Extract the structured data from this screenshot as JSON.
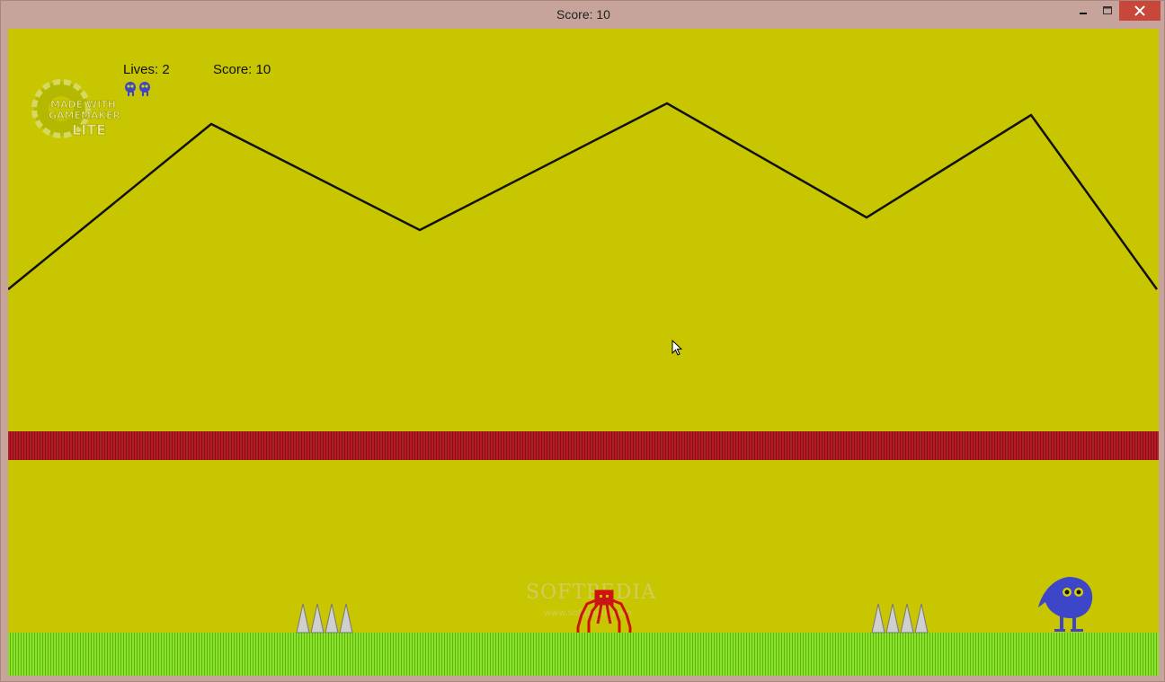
{
  "window": {
    "title": "Score: 10"
  },
  "hud": {
    "lives_text": "Lives: 2",
    "score_text": "Score: 10",
    "lives_count": 2
  },
  "logo": {
    "line1": "MADE WITH",
    "line2": "GAMEMAKER",
    "line3": "LITE"
  },
  "watermark": {
    "text": "SOFTPEDIA",
    "sub": "www.softpedia.com"
  },
  "colors": {
    "background": "#c8c600",
    "mountain_line": "#111111",
    "lava_band": "#b81a24",
    "grass": "#8ee02a",
    "player": "#3d46c8",
    "enemy": "#d01818",
    "spikes": "#c8c8c8"
  },
  "icons": {
    "minimize": "minimize-icon",
    "maximize": "maximize-icon",
    "close": "close-icon",
    "cursor": "mouse-cursor-icon"
  }
}
